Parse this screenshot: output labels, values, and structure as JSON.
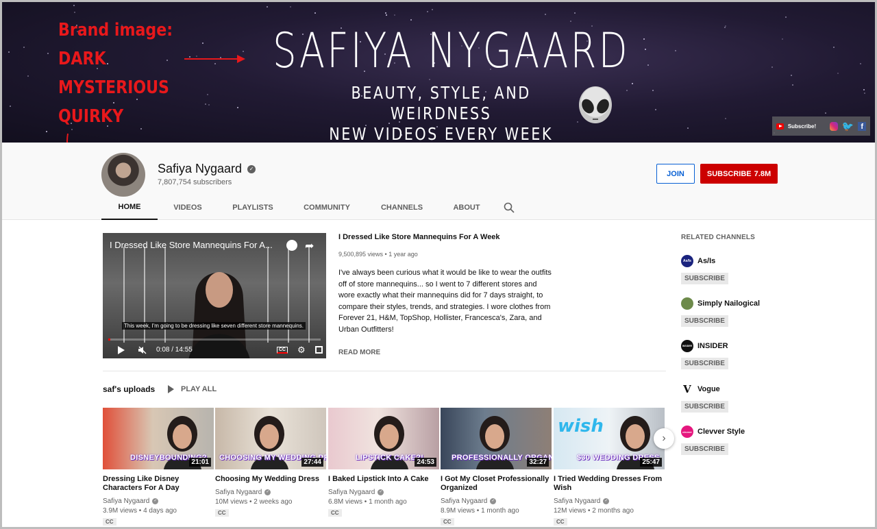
{
  "banner": {
    "title": "SAFIYA NYGAARD",
    "tagline_1": "BEAUTY, STYLE, AND WEIRDNESS",
    "tagline_2": "NEW VIDEOS EVERY WEEK",
    "links_label": "Subscribe!",
    "annotations": [
      "Brand image:",
      "DARK",
      "MYSTERIOUS",
      "QUIRKY"
    ],
    "annotation_color": "#e8181b"
  },
  "channel": {
    "name": "Safiya Nygaard",
    "subscribers": "7,807,754 subscribers",
    "join_label": "JOIN",
    "subscribe_label": "SUBSCRIBE",
    "subscribe_count": "7.8M",
    "verified_glyph": "✓"
  },
  "tabs": [
    "HOME",
    "VIDEOS",
    "PLAYLISTS",
    "COMMUNITY",
    "CHANNELS",
    "ABOUT"
  ],
  "featured": {
    "player_title": "I Dressed Like Store Mannequins For A...",
    "caption": "This week, I'm going to be dressing like seven different store mannequins.",
    "time": "0:08 / 14:55",
    "progress": 0.009,
    "cc": "CC",
    "title": "I Dressed Like Store Mannequins For A Week",
    "meta": "9,500,895 views • 1 year ago",
    "description": "I've always been curious what it would be like to wear the outfits off of store mannequins... so I went to 7 different stores and wore exactly what their mannequins did for 7 days straight, to compare their styles, trends, and strategies. I wore clothes from Forever 21, H&M, TopShop, Hollister, Francesca's, Zara, and Urban Outfitters!",
    "read_more": "READ MORE"
  },
  "uploads": {
    "heading": "saf's uploads",
    "play_all": "PLAY ALL",
    "videos": [
      {
        "thumb_text": "DISNEYBOUNDING?",
        "duration": "21:01",
        "title": "Dressing Like Disney Characters For A Day",
        "channel": "Safiya Nygaard",
        "meta": "3.9M views • 4 days ago",
        "cc": "CC"
      },
      {
        "thumb_text": "CHOOSING MY WEDDING DR",
        "duration": "27:44",
        "title": "Choosing My Wedding Dress",
        "channel": "Safiya Nygaard",
        "meta": "10M views • 2 weeks ago",
        "cc": "CC"
      },
      {
        "thumb_text": "LIPSTICK CAKE?!",
        "duration": "24:53",
        "title": "I Baked Lipstick Into A Cake",
        "channel": "Safiya Nygaard",
        "meta": "6.8M views • 1 month ago",
        "cc": "CC"
      },
      {
        "thumb_text": "PROFESSIONALLY ORGANI",
        "duration": "32:27",
        "title": "I Got My Closet Professionally Organized",
        "channel": "Safiya Nygaard",
        "meta": "8.9M views • 1 month ago",
        "cc": "CC"
      },
      {
        "thumb_text": "$30 WEDDING DRESS",
        "duration": "25:47",
        "title": "I Tried Wedding Dresses From Wish",
        "channel": "Safiya Nygaard",
        "meta": "12M views • 2 months ago",
        "cc": "CC"
      }
    ]
  },
  "related": {
    "heading": "RELATED CHANNELS",
    "subscribe_label": "SUBSCRIBE",
    "channels": [
      {
        "name": "As/Is",
        "logo": "As/Is",
        "color": "#1a237e"
      },
      {
        "name": "Simply Nailogical",
        "logo": "",
        "color": "#6d8a4a"
      },
      {
        "name": "INSIDER",
        "logo": "INSIDER",
        "color": "#111111"
      },
      {
        "name": "Vogue",
        "logo": "V",
        "color": "#ffffff"
      },
      {
        "name": "Clevver Style",
        "logo": "clevver",
        "color": "#e5177e"
      }
    ]
  },
  "colors": {
    "brand_red": "#cc0000",
    "join_blue": "#065fd4"
  }
}
